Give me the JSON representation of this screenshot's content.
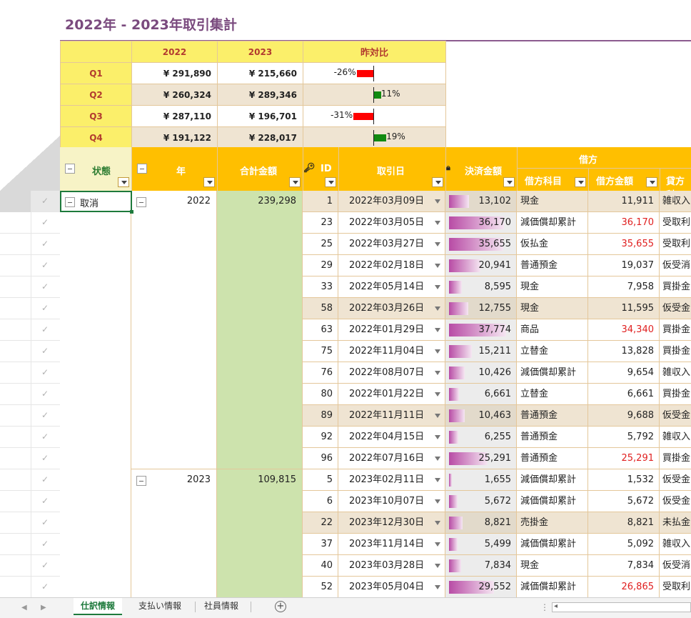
{
  "title": "2022年 - 2023年取引集計",
  "summary": {
    "headers": {
      "y2022": "2022",
      "y2023": "2023",
      "ratio": "昨対比"
    },
    "rows": [
      {
        "q": "Q1",
        "v2022": "¥ 291,890",
        "v2023": "¥ 215,660",
        "ratio_label": "-26%",
        "ratio": -26
      },
      {
        "q": "Q2",
        "v2022": "¥ 260,324",
        "v2023": "¥ 289,346",
        "ratio_label": "11%",
        "ratio": 11
      },
      {
        "q": "Q3",
        "v2022": "¥ 287,110",
        "v2023": "¥ 196,701",
        "ratio_label": "-31%",
        "ratio": -31
      },
      {
        "q": "Q4",
        "v2022": "¥ 191,122",
        "v2023": "¥ 228,017",
        "ratio_label": "19%",
        "ratio": 19
      }
    ],
    "colors": {
      "negative": "#ff0000",
      "positive": "#118a11"
    }
  },
  "table": {
    "headers": {
      "status": "状態",
      "year": "年",
      "total": "合計金額",
      "id": "ID",
      "date": "取引日",
      "payment": "決済金額",
      "debit_group": "借方",
      "debit_account": "借方科目",
      "debit_amount": "借方金額",
      "credit_account": "貸方科"
    },
    "status_value": "取消",
    "groups": [
      {
        "year": "2022",
        "total": "239,298"
      },
      {
        "year": "2023",
        "total": "109,815"
      }
    ],
    "rows": [
      {
        "id": "1",
        "date": "2022年03月09日",
        "pay": "13,102",
        "pay_ratio": 0.347,
        "acc": "現金",
        "amt": "11,911",
        "red": false,
        "cr": "雑収入",
        "alt": true
      },
      {
        "id": "23",
        "date": "2022年03月05日",
        "pay": "36,170",
        "pay_ratio": 0.958,
        "acc": "減価償却累計",
        "amt": "36,170",
        "red": true,
        "cr": "受取利",
        "alt": false
      },
      {
        "id": "25",
        "date": "2022年03月27日",
        "pay": "35,655",
        "pay_ratio": 0.944,
        "acc": "仮払金",
        "amt": "35,655",
        "red": true,
        "cr": "受取利",
        "alt": false
      },
      {
        "id": "29",
        "date": "2022年02月18日",
        "pay": "20,941",
        "pay_ratio": 0.555,
        "acc": "普通預金",
        "amt": "19,037",
        "red": false,
        "cr": "仮受消",
        "alt": false
      },
      {
        "id": "33",
        "date": "2022年05月14日",
        "pay": "8,595",
        "pay_ratio": 0.228,
        "acc": "現金",
        "amt": "7,958",
        "red": false,
        "cr": "買掛金",
        "alt": false
      },
      {
        "id": "58",
        "date": "2022年03月26日",
        "pay": "12,755",
        "pay_ratio": 0.338,
        "acc": "現金",
        "amt": "11,595",
        "red": false,
        "cr": "仮受金",
        "alt": true
      },
      {
        "id": "63",
        "date": "2022年01月29日",
        "pay": "37,774",
        "pay_ratio": 1.0,
        "acc": "商品",
        "amt": "34,340",
        "red": true,
        "cr": "買掛金",
        "alt": false
      },
      {
        "id": "75",
        "date": "2022年11月04日",
        "pay": "15,211",
        "pay_ratio": 0.403,
        "acc": "立替金",
        "amt": "13,828",
        "red": false,
        "cr": "買掛金",
        "alt": false
      },
      {
        "id": "76",
        "date": "2022年08月07日",
        "pay": "10,426",
        "pay_ratio": 0.276,
        "acc": "減価償却累計",
        "amt": "9,654",
        "red": false,
        "cr": "雑収入",
        "alt": false
      },
      {
        "id": "80",
        "date": "2022年01月22日",
        "pay": "6,661",
        "pay_ratio": 0.176,
        "acc": "立替金",
        "amt": "6,661",
        "red": false,
        "cr": "買掛金",
        "alt": false
      },
      {
        "id": "89",
        "date": "2022年11月11日",
        "pay": "10,463",
        "pay_ratio": 0.277,
        "acc": "普通預金",
        "amt": "9,688",
        "red": false,
        "cr": "仮受金",
        "alt": true
      },
      {
        "id": "92",
        "date": "2022年04月15日",
        "pay": "6,255",
        "pay_ratio": 0.166,
        "acc": "普通預金",
        "amt": "5,792",
        "red": false,
        "cr": "雑収入",
        "alt": false
      },
      {
        "id": "96",
        "date": "2022年07月16日",
        "pay": "25,291",
        "pay_ratio": 0.67,
        "acc": "普通預金",
        "amt": "25,291",
        "red": true,
        "cr": "買掛金",
        "alt": false
      },
      {
        "id": "5",
        "date": "2023年02月11日",
        "pay": "1,655",
        "pay_ratio": 0.044,
        "acc": "減価償却累計",
        "amt": "1,532",
        "red": false,
        "cr": "仮受金",
        "alt": false
      },
      {
        "id": "6",
        "date": "2023年10月07日",
        "pay": "5,672",
        "pay_ratio": 0.15,
        "acc": "減価償却累計",
        "amt": "5,672",
        "red": false,
        "cr": "仮受金",
        "alt": false
      },
      {
        "id": "22",
        "date": "2023年12月30日",
        "pay": "8,821",
        "pay_ratio": 0.234,
        "acc": "売掛金",
        "amt": "8,821",
        "red": false,
        "cr": "未払金",
        "alt": true
      },
      {
        "id": "37",
        "date": "2023年11月14日",
        "pay": "5,499",
        "pay_ratio": 0.146,
        "acc": "減価償却累計",
        "amt": "5,092",
        "red": false,
        "cr": "雑収入",
        "alt": false
      },
      {
        "id": "40",
        "date": "2023年03月28日",
        "pay": "7,834",
        "pay_ratio": 0.207,
        "acc": "現金",
        "amt": "7,834",
        "red": false,
        "cr": "仮受消",
        "alt": false
      },
      {
        "id": "52",
        "date": "2023年05月04日",
        "pay": "29,552",
        "pay_ratio": 0.782,
        "acc": "減価償却累計",
        "amt": "26,865",
        "red": true,
        "cr": "受取利",
        "alt": false
      }
    ]
  },
  "sheet_tabs": [
    {
      "label": "仕訳情報",
      "active": true
    },
    {
      "label": "支払い情報",
      "active": false
    },
    {
      "label": "社員情報",
      "active": false
    }
  ],
  "add_tab": "⊕"
}
